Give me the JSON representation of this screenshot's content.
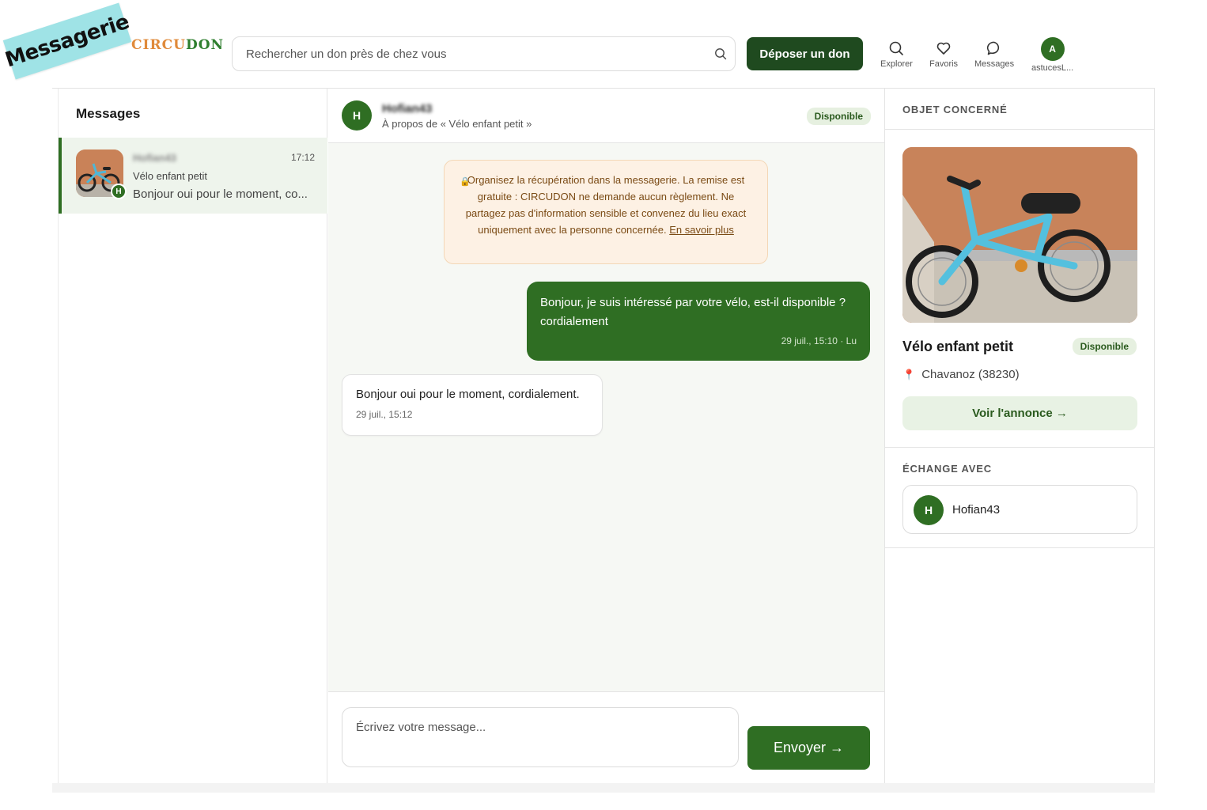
{
  "sticker": "Messagerie",
  "header": {
    "logo_prefix": "C",
    "logo_text": "IRCU",
    "logo_text_b": "DON",
    "search_placeholder": "Rechercher un don près de chez vous",
    "deposit_label": "Déposer un don",
    "nav": {
      "explore": "Explorer",
      "favorites": "Favoris",
      "messages": "Messages",
      "account_initial": "A",
      "account_label": "astucesL..."
    }
  },
  "sidebar": {
    "title": "Messages",
    "conversation": {
      "name": "Hofian43",
      "time": "17:12",
      "object": "Vélo enfant petit",
      "last_message": "Bonjour oui pour le moment, co...",
      "badge": "H"
    }
  },
  "chat": {
    "avatar": "H",
    "name": "Hofian43",
    "subtitle": "À propos de « Vélo enfant petit »",
    "status": "Disponible",
    "notice_text": "Organisez la récupération dans la messagerie. La remise est gratuite : CIRCUDON ne demande aucun règlement. Ne partagez pas d'information sensible et convenez du lieu exact uniquement avec la personne concernée.",
    "notice_link": "En savoir plus",
    "messages": [
      {
        "direction": "out",
        "text": "Bonjour, je suis intéressé par votre vélo, est-il disponible ? cordialement",
        "meta": "29 juil., 15:10 · Lu"
      },
      {
        "direction": "in",
        "text": "Bonjour oui pour le moment, cordialement.",
        "meta": "29 juil., 15:12"
      }
    ],
    "composer_placeholder": "Écrivez votre message...",
    "send_label": "Envoyer →"
  },
  "details": {
    "object_title": "OBJET CONCERNÉ",
    "product_name": "Vélo enfant petit",
    "status": "Disponible",
    "location": "Chavanoz (38230)",
    "view_label": "Voir l'annonce →",
    "exchange_title": "ÉCHANGE AVEC",
    "partner_initial": "H",
    "partner_name": "Hofian43"
  }
}
